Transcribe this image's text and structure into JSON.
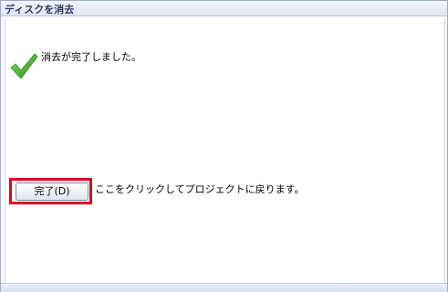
{
  "window": {
    "title": "ディスクを消去"
  },
  "status": {
    "icon": "checkmark-icon",
    "message": "消去が完了しました。",
    "icon_color": "#5ab53c"
  },
  "finish": {
    "button_label": "完了(D)",
    "hint": "ここをクリックしてプロジェクトに戻ります。",
    "highlight_color": "#e0001e"
  }
}
